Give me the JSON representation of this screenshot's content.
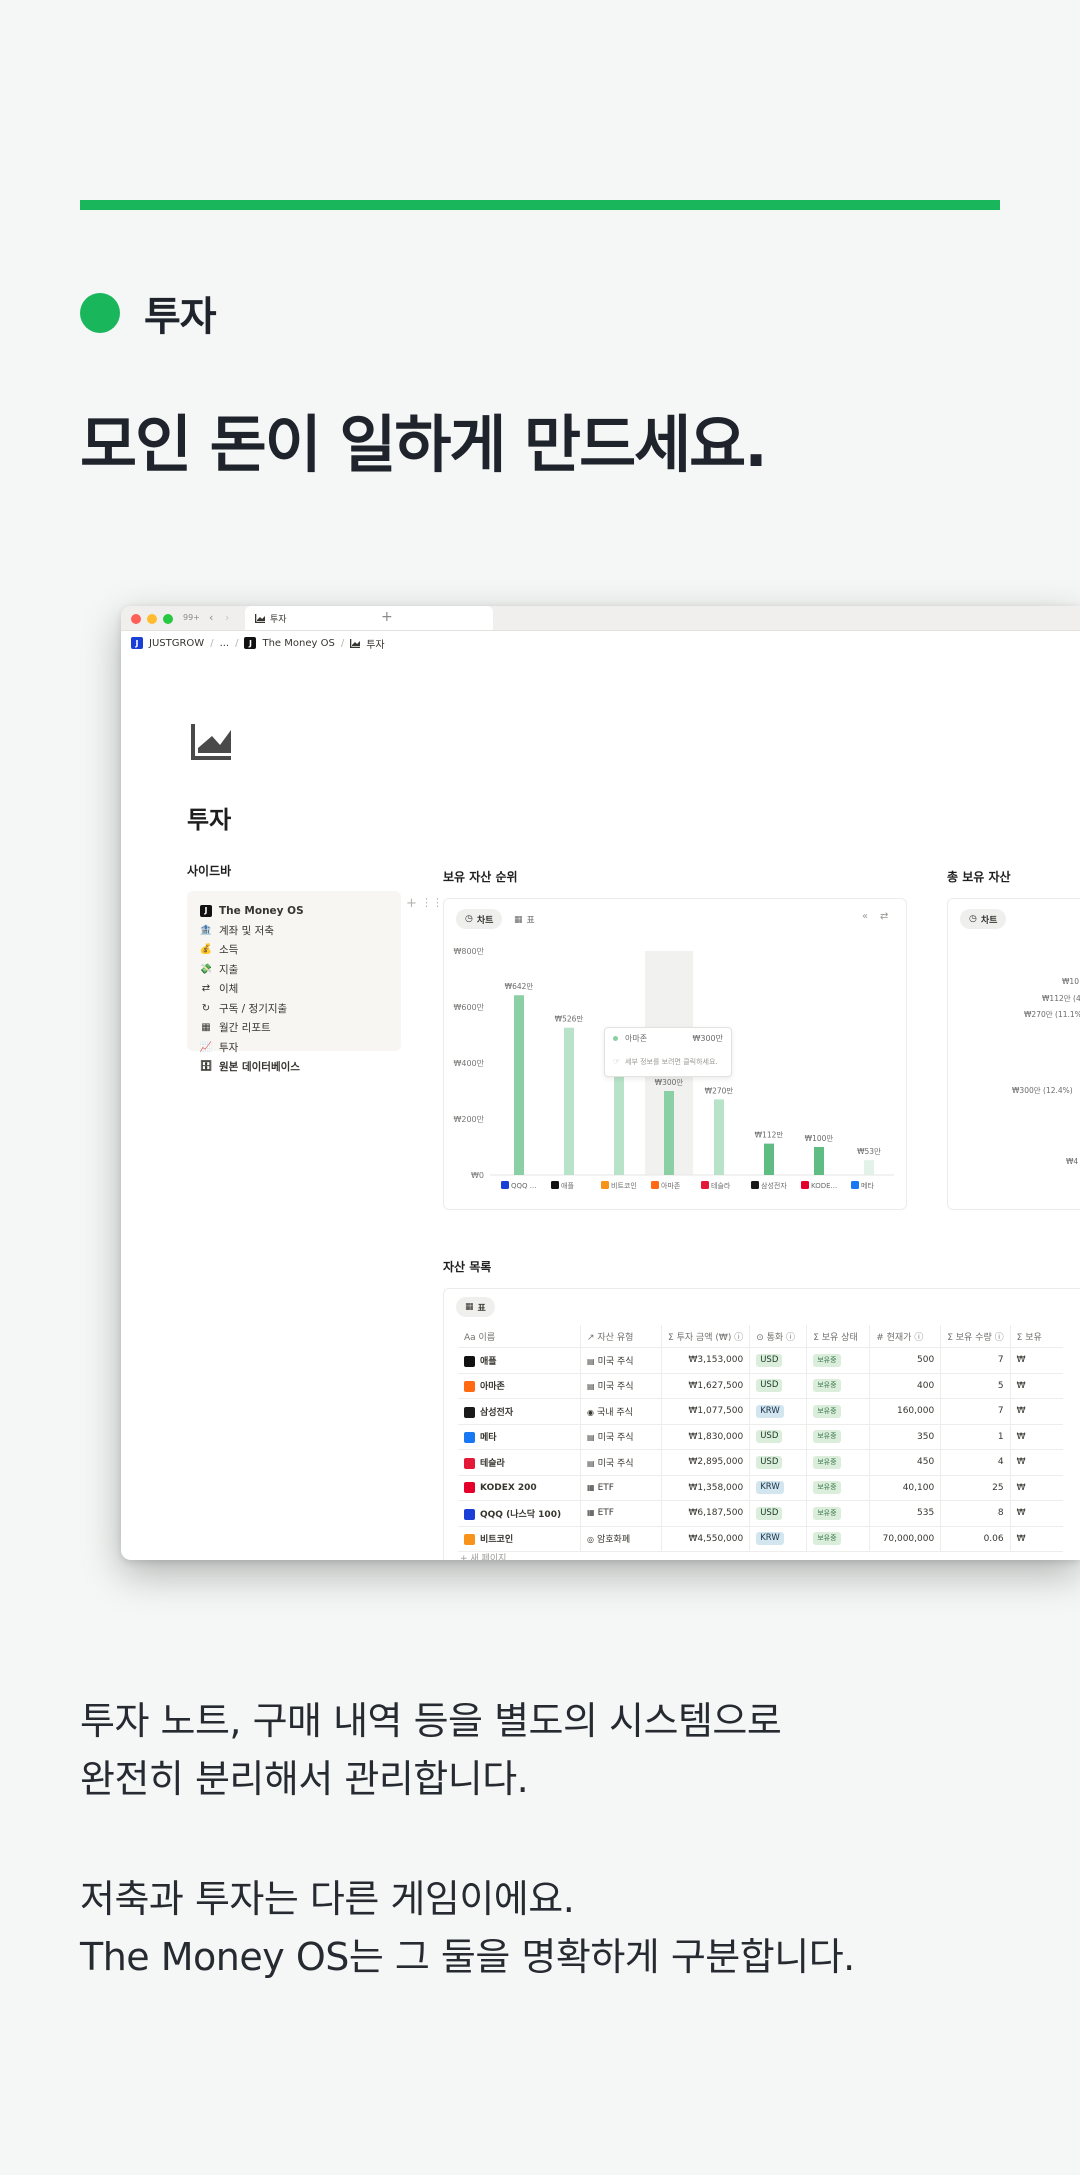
{
  "section": {
    "label": "투자"
  },
  "headline": "모인 돈이 일하게 만드세요.",
  "description": {
    "line1": "투자 노트, 구매 내역 등을 별도의 시스템으로",
    "line2": "완전히 분리해서 관리합니다.",
    "line3": "저축과 투자는 다른 게임이에요.",
    "line4": "The Money OS는 그 둘을 명확하게 구분합니다."
  },
  "colors": {
    "accent": "#19b65c",
    "bar_dark": "#8bcfa5",
    "bar_light": "#b9e3c8",
    "bar_deep": "#5fbd83"
  },
  "window": {
    "tab_count": "99+",
    "tab_title": "투자",
    "breadcrumb": [
      "JUSTGROW",
      "...",
      "The Money OS",
      "투자"
    ]
  },
  "page": {
    "icon": "chart-area-icon",
    "title": "투자",
    "sidebar_heading": "사이드바",
    "sidebar_items": [
      {
        "label": "The Money OS",
        "icon": "logo-icon"
      },
      {
        "label": "계좌 및 저축",
        "icon": "bank-icon"
      },
      {
        "label": "소득",
        "icon": "money-hand-icon"
      },
      {
        "label": "지출",
        "icon": "money-out-icon"
      },
      {
        "label": "이체",
        "icon": "transfer-icon"
      },
      {
        "label": "구독 / 정기지출",
        "icon": "repeat-icon"
      },
      {
        "label": "월간 리포트",
        "icon": "calendar-icon"
      },
      {
        "label": "투자",
        "icon": "chart-icon"
      },
      {
        "label": "원본 데이터베이스",
        "icon": "database-icon"
      }
    ]
  },
  "holdings_ranking": {
    "title": "보유 자산 순위",
    "view_chart": "차트",
    "view_table": "표",
    "tooltip": {
      "name": "아마존",
      "value": "₩300만",
      "hint": "세부 정보를 보려면 클릭하세요."
    }
  },
  "total_holdings": {
    "title": "총 보유 자산",
    "view_chart": "차트",
    "labels": [
      "₩10",
      "₩112만 (4",
      "₩270만 (11.1%)",
      "₩300만 (12.4%)",
      "₩4"
    ]
  },
  "chart_data": {
    "type": "bar",
    "title": "보유 자산 순위",
    "categories": [
      "QQQ ...",
      "애플",
      "비트코인",
      "아마존",
      "테슬라",
      "삼성전자",
      "KODE...",
      "메타"
    ],
    "values": [
      642,
      526,
      455,
      300,
      270,
      112,
      100,
      53
    ],
    "value_labels": [
      "₩642만",
      "₩526만",
      "",
      "₩300만",
      "₩270만",
      "₩112만",
      "₩100만",
      "₩53만"
    ],
    "ytick_labels": [
      "₩0",
      "₩200만",
      "₩400만",
      "₩600만",
      "₩800만"
    ],
    "yticks": [
      0,
      200,
      400,
      600,
      800
    ],
    "ylim": [
      0,
      800
    ],
    "highlighted": "아마존",
    "grid": false
  },
  "asset_list": {
    "title": "자산 목록",
    "view_table": "표",
    "columns": [
      "이름",
      "자산 유형",
      "투자 금액 (₩)",
      "통화",
      "보유 상태",
      "현재가",
      "보유 수량",
      "보유"
    ],
    "rows": [
      {
        "name": "애플",
        "type": "미국 주식",
        "invested": "₩3,153,000",
        "currency": "USD",
        "status": "보유중",
        "price": "500",
        "qty": "7",
        "extra": "₩",
        "color": "#111111"
      },
      {
        "name": "아마존",
        "type": "미국 주식",
        "invested": "₩1,627,500",
        "currency": "USD",
        "status": "보유중",
        "price": "400",
        "qty": "5",
        "extra": "₩",
        "color": "#ff6a13"
      },
      {
        "name": "삼성전자",
        "type": "국내 주식",
        "invested": "₩1,077,500",
        "currency": "KRW",
        "status": "보유중",
        "price": "160,000",
        "qty": "7",
        "extra": "₩",
        "color": "#1a1a1a"
      },
      {
        "name": "메타",
        "type": "미국 주식",
        "invested": "₩1,830,000",
        "currency": "USD",
        "status": "보유중",
        "price": "350",
        "qty": "1",
        "extra": "₩",
        "color": "#1877f2"
      },
      {
        "name": "테슬라",
        "type": "미국 주식",
        "invested": "₩2,895,000",
        "currency": "USD",
        "status": "보유중",
        "price": "450",
        "qty": "4",
        "extra": "₩",
        "color": "#e31937"
      },
      {
        "name": "KODEX 200",
        "type": "ETF",
        "invested": "₩1,358,000",
        "currency": "KRW",
        "status": "보유중",
        "price": "40,100",
        "qty": "25",
        "extra": "₩",
        "color": "#e4002b"
      },
      {
        "name": "QQQ (나스닥 100)",
        "type": "ETF",
        "invested": "₩6,187,500",
        "currency": "USD",
        "status": "보유중",
        "price": "535",
        "qty": "8",
        "extra": "₩",
        "color": "#1a3fd6"
      },
      {
        "name": "비트코인",
        "type": "암호화폐",
        "invested": "₩4,550,000",
        "currency": "KRW",
        "status": "보유중",
        "price": "70,000,000",
        "qty": "0.06",
        "extra": "₩",
        "color": "#f7931a"
      }
    ],
    "new_page": "+ 새 페이지"
  }
}
